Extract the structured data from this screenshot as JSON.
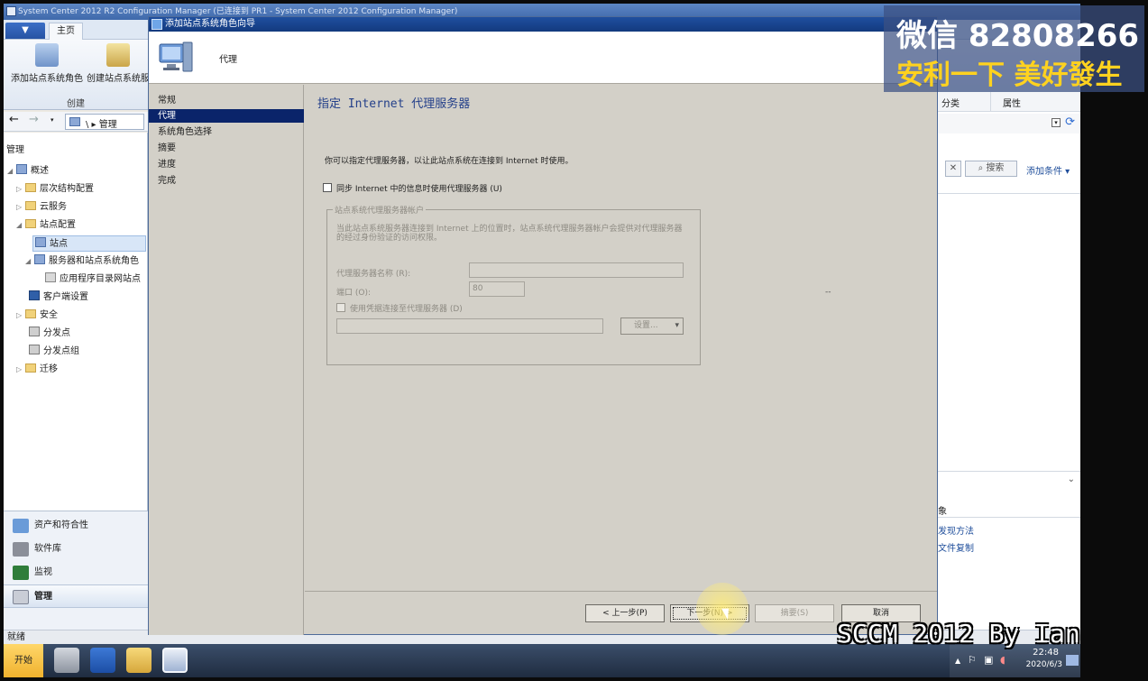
{
  "console": {
    "title": "System Center 2012 R2 Configuration Manager (已连接到 PR1 - System Center 2012 Configuration Manager)",
    "file_tab": "▼",
    "home_tab": "主页",
    "ribbon_buttons": [
      "添加站点系统角色",
      "创建站点系统服"
    ],
    "ribbon_group": "创建",
    "breadcrumb": "\\ ▸ 管理",
    "left_header": "管理",
    "tree": [
      {
        "label": "概述",
        "level": 0,
        "expander": "◢"
      },
      {
        "label": "层次结构配置",
        "level": 1,
        "expander": "▷"
      },
      {
        "label": "云服务",
        "level": 1,
        "expander": "▷"
      },
      {
        "label": "站点配置",
        "level": 1,
        "expander": "◢"
      },
      {
        "label": "站点",
        "level": 2,
        "expander": ""
      },
      {
        "label": "服务器和站点系统角色",
        "level": 2,
        "expander": "◢"
      },
      {
        "label": "应用程序目录网站点",
        "level": 3,
        "expander": ""
      },
      {
        "label": "客户端设置",
        "level": 1,
        "expander": ""
      },
      {
        "label": "安全",
        "level": 1,
        "expander": "▷"
      },
      {
        "label": "分发点",
        "level": 1,
        "expander": ""
      },
      {
        "label": "分发点组",
        "level": 1,
        "expander": ""
      },
      {
        "label": "迁移",
        "level": 1,
        "expander": "▷"
      }
    ],
    "workspaces": [
      "资产和符合性",
      "软件库",
      "监视",
      "管理"
    ],
    "status": "就绪",
    "right_columns": [
      "分类",
      "属性"
    ],
    "right_clear": "✕",
    "right_search": "搜索",
    "right_add_criteria": "添加条件 ▾",
    "right_section": "象",
    "right_links": [
      "发现方法",
      "文件复制"
    ]
  },
  "taskbar": {
    "start": "开始",
    "time": "22:48",
    "date": "2020/6/3"
  },
  "wizard": {
    "title": "添加站点系统角色向导",
    "header": "代理",
    "steps": [
      "常规",
      "代理",
      "系统角色选择",
      "摘要",
      "进度",
      "完成"
    ],
    "current_step": 1,
    "heading": "指定 Internet 代理服务器",
    "description": "你可以指定代理服务器，以让此站点系统在连接到 Internet 时使用。",
    "sync_checkbox": "同步 Internet 中的信息时使用代理服务器 (U)",
    "group_title": "站点系统代理服务器帐户",
    "group_info": "当此站点系统服务器连接到 Internet 上的位置时，站点系统代理服务器帐户会提供对代理服务器的经过身份验证的访问权限。",
    "proxy_name_label": "代理服务器名称 (R):",
    "proxy_name_value": "",
    "port_label": "端口 (O):",
    "port_value": "80",
    "credentials_checkbox": "使用凭据连接至代理服务器 (D)",
    "account_value": "",
    "settings_button": "设置...",
    "buttons": {
      "previous": "< 上一步(P)",
      "next": "下一步(N) >",
      "summary": "摘要(S)",
      "cancel": "取消"
    }
  },
  "overlay": {
    "wechat": "微信 82808266",
    "slogan": "安利一下 美好發生",
    "caption": "SCCM 2012 By Ian"
  },
  "colors": {
    "wizard_title": "#1f4f9f",
    "nav_selected": "#0a246a",
    "heading": "#24408a",
    "watermark_yellow": "#ffd21f"
  }
}
